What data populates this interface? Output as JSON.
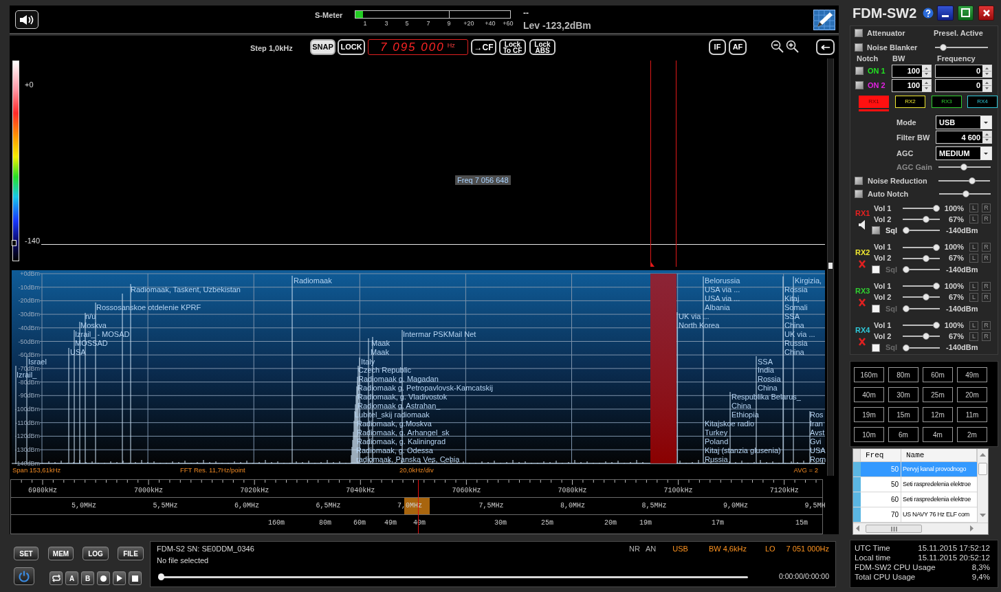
{
  "meter_bar": {
    "s_meter": {
      "label": "S-Meter",
      "level": 0.05,
      "scale": [
        "1",
        "3",
        "5",
        "7",
        "9",
        "+20",
        "+40",
        "+60"
      ]
    },
    "reading": "--",
    "level_text": "Lev -123,2dBm"
  },
  "toolbar": {
    "step": "Step 1,0kHz",
    "mode_buttons": [
      {
        "label": "SNAP",
        "selected": true
      },
      {
        "label": "LOCK",
        "selected": false
      }
    ],
    "frequency": {
      "value": "7 095 000",
      "unit": "Hz"
    },
    "center_buttons": [
      {
        "lines": [
          "→CF"
        ]
      },
      {
        "lines": [
          "Lock",
          "To CF"
        ]
      },
      {
        "lines": [
          "Lock",
          "ABS"
        ]
      }
    ],
    "filter_buttons": [
      "IF",
      "AF"
    ]
  },
  "waterfall": {
    "scale_labels": [
      "+0",
      "-140"
    ],
    "tooltip": "Freq 7 056 648"
  },
  "spectrum": {
    "y_labels": [
      "+0dBm",
      "-10dBm",
      "-20dBm",
      "-30dBm",
      "-40dBm",
      "-50dBm",
      "-60dBm",
      "-70dBm",
      "-80dBm",
      "-90dBm",
      "-100dBm",
      "-110dBm",
      "-120dBm",
      "-130dBm",
      "-140dBm"
    ],
    "stations": [
      "Radiomaak",
      "Belorussia",
      "Kirgizia,",
      "Radiomaak, Taskent, Uzbekistan",
      "USA via ...",
      "Rossia",
      "USA via ...",
      "Kitaj",
      "Rossosanskoe otdelenie KPRF",
      "Albania",
      "Somali",
      "n/u",
      "UK via ...",
      "SSA",
      "Moskva",
      "North Korea",
      "China",
      "Izrail_ - MOSAD",
      "Intermar PSKMail Net",
      "UK via ...",
      "MOSSAD",
      "Maak",
      "Russia",
      "USA",
      "Maak",
      "China",
      "Israel",
      "Italy",
      "SSA",
      "Czech Republic",
      "India",
      "Izrail_",
      "Radiomaak g. Magadan",
      "Rossia",
      "Radiomaak g. Petropavlovsk-Kamcatskij",
      "China",
      "Radiomaak, g. Vladivostok",
      "Respublika Belarus_",
      "Radiomaak g. Astrahan_",
      "China",
      "Lubitel_skij radiomaak",
      "Ethiopia",
      "Ros",
      "Radiomaak, g.Moskva",
      "Kitajskoe radio",
      "Iran",
      "Radiomaak, g. Arhangel_sk",
      "Turkey",
      "Avst",
      "Radiomaak, g. Kaliningrad",
      "Poland",
      "Gvi",
      "Radiomaak, g. Odessa",
      "Kitaj (stanzia glusenia)",
      "USA",
      "radiomaak, Panska Ves, Cehia",
      "Russia",
      "Rom"
    ],
    "footer": {
      "span": "Span 153,61kHz",
      "resolution": "FFT Res. 11,7Hz/point",
      "division": "20,0kHz/div",
      "average": "AVG = 2"
    }
  },
  "frequency_scale": {
    "khz": [
      "6980kHz",
      "7000kHz",
      "7020kHz",
      "7040kHz",
      "7060kHz",
      "7080kHz",
      "7100kHz",
      "7120kHz"
    ],
    "mhz": [
      "5,0MHz",
      "5,5MHz",
      "6,0MHz",
      "6,5MHz",
      "7,0MHz",
      "7,5MHz",
      "8,0MHz",
      "8,5MHz",
      "9,0MHz",
      "9,5MH"
    ],
    "bands": [
      "160m",
      "80m",
      "60m",
      "49m",
      "40m",
      "30m",
      "25m",
      "20m",
      "19m",
      "17m",
      "15m"
    ]
  },
  "bottom_buttons": [
    "SET",
    "MEM",
    "LOG",
    "FILE"
  ],
  "transport": [
    {
      "kind": "loop"
    },
    {
      "kind": "letter",
      "label": "A"
    },
    {
      "kind": "letter",
      "label": "B"
    },
    {
      "kind": "record"
    },
    {
      "kind": "play"
    },
    {
      "kind": "stop"
    }
  ],
  "info_panel": {
    "device": "FDM-S2 SN: SE0DDM_0346",
    "file": "No file selected",
    "status": [
      {
        "text": "NR",
        "color": "#b4b4b4"
      },
      {
        "text": "AN",
        "color": "#b4b4b4"
      },
      {
        "text": "USB",
        "color": "#ff9420"
      },
      {
        "text": "BW 4,6kHz",
        "color": "#ff9420"
      },
      {
        "text": "LO",
        "color": "#ff9420"
      },
      {
        "text": "7 051 000Hz",
        "color": "#ff9420"
      }
    ],
    "playback": {
      "level": 0,
      "time": "0:00:00/0:00:00"
    }
  },
  "title": "FDM-SW2",
  "controls": {
    "attenuator": {
      "label": "Attenuator",
      "checked": false
    },
    "preselector": "Presel. Active",
    "noise_blanker": {
      "label": "Noise Blanker",
      "checked": false,
      "level": 0.1
    },
    "notch": {
      "columns": [
        "Notch",
        "BW",
        "Frequency"
      ],
      "rows": [
        {
          "label": "ON 1",
          "color": "#22e022",
          "checked": false,
          "bw": "100",
          "frequency": "0"
        },
        {
          "label": "ON 2",
          "color": "#e022e0",
          "checked": false,
          "bw": "100",
          "frequency": "0"
        }
      ]
    },
    "rx_tabs": [
      {
        "label": "RX1",
        "color": "#ff1010",
        "selected": true
      },
      {
        "label": "RX2",
        "color": "#f0e830",
        "selected": false
      },
      {
        "label": "RX3",
        "color": "#30d030",
        "selected": false
      },
      {
        "label": "RX4",
        "color": "#30c8d8",
        "selected": false
      }
    ],
    "mode": {
      "label": "Mode",
      "value": "USB"
    },
    "filter_bw": {
      "label": "Filter BW",
      "value": "4 600"
    },
    "agc": {
      "label": "AGC",
      "value": "MEDIUM"
    },
    "agc_gain": {
      "label": "AGC Gain",
      "disabled": true,
      "level": 0.48
    },
    "noise_reduction": {
      "label": "Noise Reduction",
      "checked": false,
      "level": 0.68
    },
    "auto_notch": {
      "label": "Auto Notch",
      "checked": false,
      "level": 0.52
    }
  },
  "receivers": [
    {
      "label": "RX1",
      "color": "#e82020",
      "muted": false,
      "volumes": [
        {
          "label": "Vol 1",
          "level": 1,
          "reading": "100%",
          "channels": [
            "L",
            "R"
          ]
        },
        {
          "label": "Vol 2",
          "level": 0.67,
          "reading": "67%",
          "channels": [
            "L",
            "R"
          ]
        }
      ],
      "squelch": {
        "label": "Sql",
        "checked": false,
        "disabled": false,
        "level": 0,
        "reading": "-140dBm"
      }
    },
    {
      "label": "RX2",
      "color": "#f0e830",
      "muted": true,
      "volumes": [
        {
          "label": "Vol 1",
          "level": 1,
          "reading": "100%",
          "channels": [
            "L",
            "R"
          ]
        },
        {
          "label": "Vol 2",
          "level": 0.67,
          "reading": "67%",
          "channels": [
            "L",
            "R"
          ]
        }
      ],
      "squelch": {
        "label": "Sql",
        "checked": false,
        "disabled": true,
        "level": 0,
        "reading": "-140dBm"
      }
    },
    {
      "label": "RX3",
      "color": "#30d030",
      "muted": true,
      "volumes": [
        {
          "label": "Vol 1",
          "level": 1,
          "reading": "100%",
          "channels": [
            "L",
            "R"
          ]
        },
        {
          "label": "Vol 2",
          "level": 0.67,
          "reading": "67%",
          "channels": [
            "L",
            "R"
          ]
        }
      ],
      "squelch": {
        "label": "Sql",
        "checked": false,
        "disabled": true,
        "level": 0,
        "reading": "-140dBm"
      }
    },
    {
      "label": "RX4",
      "color": "#30c8d8",
      "muted": true,
      "volumes": [
        {
          "label": "Vol 1",
          "level": 1,
          "reading": "100%",
          "channels": [
            "L",
            "R"
          ]
        },
        {
          "label": "Vol 2",
          "level": 0.67,
          "reading": "67%",
          "channels": [
            "L",
            "R"
          ]
        }
      ],
      "squelch": {
        "label": "Sql",
        "checked": false,
        "disabled": true,
        "level": 0,
        "reading": "-140dBm"
      }
    }
  ],
  "bands": [
    "160m",
    "80m",
    "60m",
    "49m",
    "40m",
    "30m",
    "25m",
    "20m",
    "19m",
    "15m",
    "12m",
    "11m",
    "10m",
    "6m",
    "4m",
    "2m"
  ],
  "station_table": {
    "columns": [
      "Freq",
      "Name"
    ],
    "rows": [
      {
        "freq": "50",
        "name": "Pervyj kanal provodnogo",
        "selected": true
      },
      {
        "freq": "50",
        "name": "Seti raspredelenia elektroe",
        "selected": false
      },
      {
        "freq": "60",
        "name": "Seti raspredelenia elektroe",
        "selected": false
      },
      {
        "freq": "70",
        "name": "US NAVY 76 Hz ELF com",
        "selected": false
      }
    ]
  },
  "system_info": [
    {
      "label": "UTC Time",
      "value": "15.11.2015 17:52:12"
    },
    {
      "label": "Local time",
      "value": "15.11.2015 20:52:12"
    },
    {
      "label": "FDM-SW2 CPU Usage",
      "value": "8,3%"
    },
    {
      "label": "Total CPU Usage",
      "value": "9,4%"
    }
  ]
}
